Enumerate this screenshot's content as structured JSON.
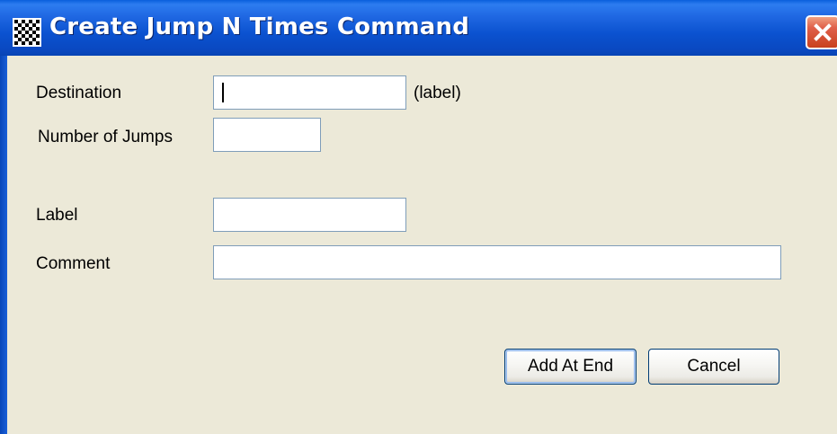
{
  "window": {
    "title": "Create Jump N Times Command",
    "icon": "app-pattern-icon",
    "close_icon": "close-icon"
  },
  "form": {
    "destination_label": "Destination",
    "destination_value": "",
    "destination_hint": "(label)",
    "jumps_label": "Number of Jumps",
    "jumps_value": "",
    "label_label": "Label",
    "label_value": "",
    "comment_label": "Comment",
    "comment_value": ""
  },
  "buttons": {
    "add_at_end": "Add At End",
    "cancel": "Cancel"
  },
  "colors": {
    "titlebar": "#0a52d0",
    "client_bg": "#ece9d8",
    "field_border": "#7f9db9",
    "close_button": "#d8573a"
  }
}
